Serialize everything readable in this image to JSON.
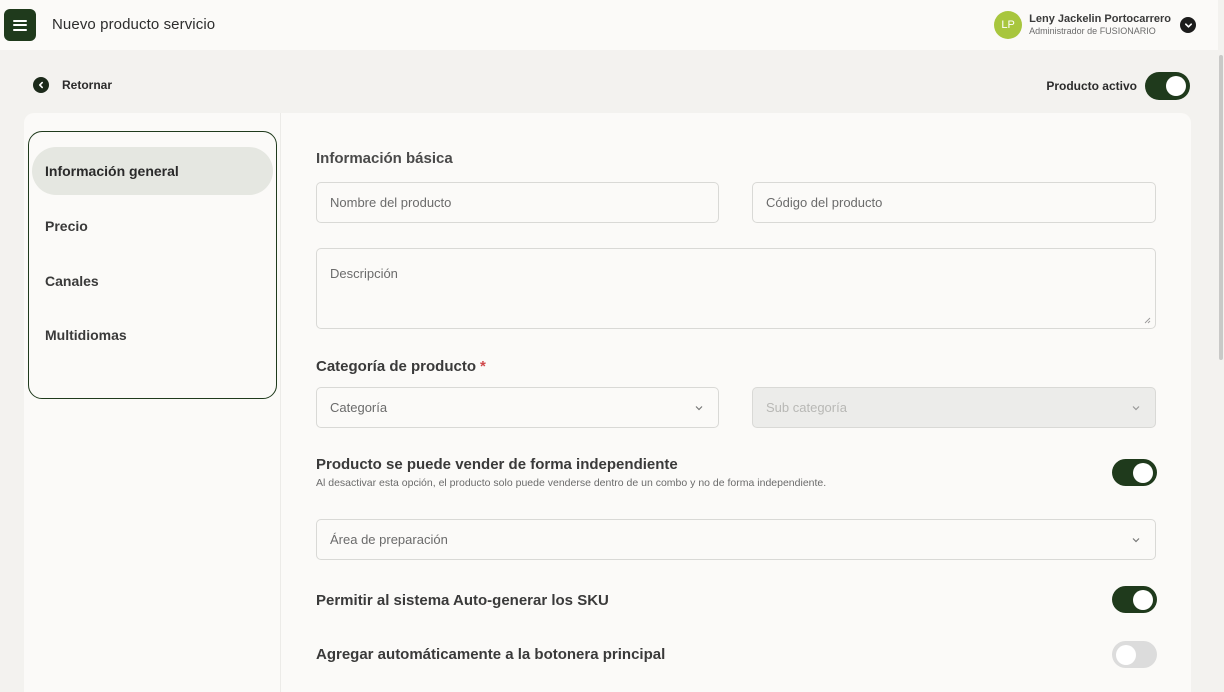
{
  "header": {
    "title": "Nuevo producto servicio",
    "user": {
      "initials": "LP",
      "name": "Leny Jackelin Portocarrero",
      "role": "Administrador de FUSIONARIO"
    }
  },
  "nav": {
    "back_label": "Retornar",
    "active_label": "Producto activo",
    "active_on": true
  },
  "sidebar": {
    "items": [
      {
        "label": "Información general",
        "active": true
      },
      {
        "label": "Precio",
        "active": false
      },
      {
        "label": "Canales",
        "active": false
      },
      {
        "label": "Multidiomas",
        "active": false
      }
    ]
  },
  "form": {
    "basic_title": "Información básica",
    "name_placeholder": "Nombre del producto",
    "code_placeholder": "Código del producto",
    "description_placeholder": "Descripción",
    "category_title": "Categoría de producto",
    "required_mark": "*",
    "category_placeholder": "Categoría",
    "subcategory_placeholder": "Sub categoría",
    "independent_title": "Producto se puede vender de forma independiente",
    "independent_desc": "Al desactivar esta opción, el producto solo puede venderse dentro de un combo y no de forma independiente.",
    "independent_on": true,
    "prep_area_placeholder": "Área de preparación",
    "sku_title": "Permitir al sistema Auto-generar los SKU",
    "sku_on": true,
    "main_panel_title": "Agregar automáticamente a la botonera principal",
    "main_panel_on": false
  },
  "colors": {
    "brand": "#1f3a1c",
    "avatar": "#a8c63e",
    "required": "#d0474a"
  }
}
